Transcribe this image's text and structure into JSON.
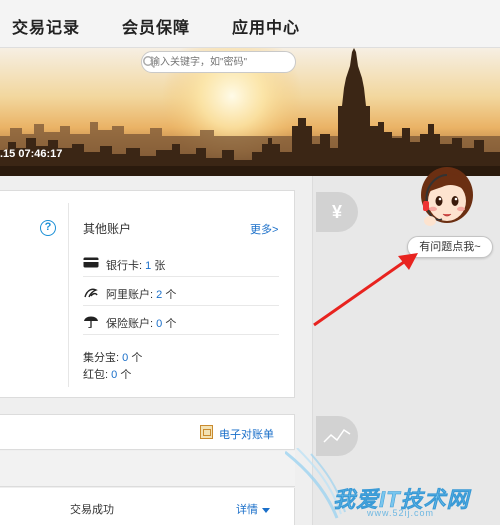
{
  "nav": {
    "items": [
      "交易记录",
      "会员保障",
      "应用中心"
    ]
  },
  "banner": {
    "search_placeholder": "输入关键字，如\"密码\"",
    "timestamp": ".15 07:46:17"
  },
  "right_strip": {
    "yen_symbol": "¥"
  },
  "help_icon": "?",
  "other_accounts": {
    "title": "其他账户",
    "more_label": "更多>",
    "rows": [
      {
        "label": "银行卡:",
        "value": "1",
        "unit": "张",
        "icon": "bank-card-icon"
      },
      {
        "label": "阿里账户:",
        "value": "2",
        "unit": "个",
        "icon": "ali-logo-icon"
      },
      {
        "label": "保险账户:",
        "value": "0",
        "unit": "个",
        "icon": "umbrella-icon"
      }
    ],
    "jifenbao": {
      "label": "集分宝:",
      "value": "0",
      "unit": "个"
    },
    "hongbao": {
      "label": "红包:",
      "value": "0",
      "unit": "个"
    }
  },
  "bill": {
    "label": "电子对账单"
  },
  "transaction": {
    "status": "交易成功",
    "detail_label": "详情"
  },
  "assistant": {
    "bubble_text": "有问题点我~"
  },
  "watermark": {
    "text": "我爱IT技术网",
    "url": "www.52ij.com"
  },
  "colors": {
    "link": "#1a6fc9",
    "help_blue": "#1a8fd6",
    "arrow_red": "#e8231f",
    "watermark_blue": "#79c6ee"
  }
}
